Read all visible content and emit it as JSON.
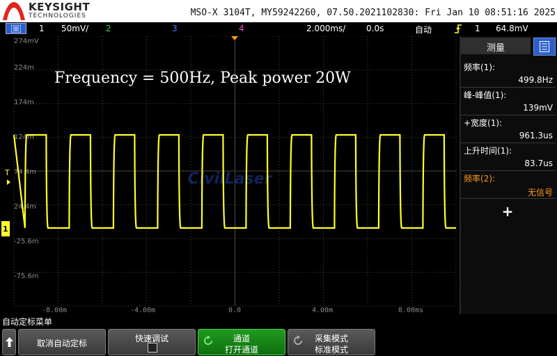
{
  "header": {
    "brand": "KEYSIGHT",
    "brand_sub": "TECHNOLOGIES",
    "device_info": "MSO-X 3104T, MY59242260, 07.50.2021102830: Fri Jan 10 08:51:16 2025"
  },
  "channel_bar": {
    "ch1_num": "1",
    "ch1_scale": "50mV/",
    "ch2_num": "2",
    "ch3_num": "3",
    "ch4_num": "4",
    "timebase": "2.000ms/",
    "delay": "0.0s",
    "trigger_mode": "自动",
    "trigger_source": "1",
    "trigger_level": "64.8mV"
  },
  "plot": {
    "annotation": "Frequency = 500Hz, Peak power 20W",
    "watermark": "CivilLaser",
    "y_labels": [
      "274mV",
      "224m",
      "174m",
      "124m",
      "74.4m",
      "24.4m",
      "-25.6m",
      "-75.6m"
    ],
    "x_labels": [
      "-8.00m",
      "-4.00m",
      "0.0",
      "4.00m",
      "8.00ms"
    ],
    "trigger_marker": "T",
    "ch1_marker": "1"
  },
  "chart_data": {
    "type": "line",
    "series": [
      {
        "name": "1",
        "waveform": "square",
        "frequency_hz": 500,
        "high_mV": 128,
        "low_mV": -10,
        "rise_time_us": 83.7,
        "positive_width_us": 961.3
      }
    ],
    "x_range_ms": [
      -10,
      10
    ],
    "y_range_mV": [
      -125.6,
      274.4
    ],
    "grid": true,
    "colors": {
      "trace": "#ffff2a",
      "grid": "#4a4a4a"
    }
  },
  "panel": {
    "title": "测量",
    "measurements": [
      {
        "label": "频率(1):",
        "value": "499.8Hz"
      },
      {
        "label": "峰-峰值(1):",
        "value": "139mV"
      },
      {
        "label": "+宽度(1):",
        "value": "961.3us"
      },
      {
        "label": "上升时间(1):",
        "value": "83.7us"
      },
      {
        "label": "频率(2):",
        "value": "无信号"
      }
    ],
    "add_label": "+"
  },
  "softkeys": {
    "menu_title": "自动定标菜单",
    "undo_autoscale": "取消自动定标",
    "quick_debug": "快速调试",
    "channel_line1": "通道",
    "channel_line2": "打开通道",
    "acq_line1": "采集模式",
    "acq_line2": "标准模式"
  },
  "colors": {
    "ch1": "#ffff2a",
    "ch2": "#33dd33",
    "ch3": "#4d7dff",
    "ch4": "#ff4ad2",
    "accent_blue": "#2d5fc9",
    "orange": "#ff9a1a"
  }
}
